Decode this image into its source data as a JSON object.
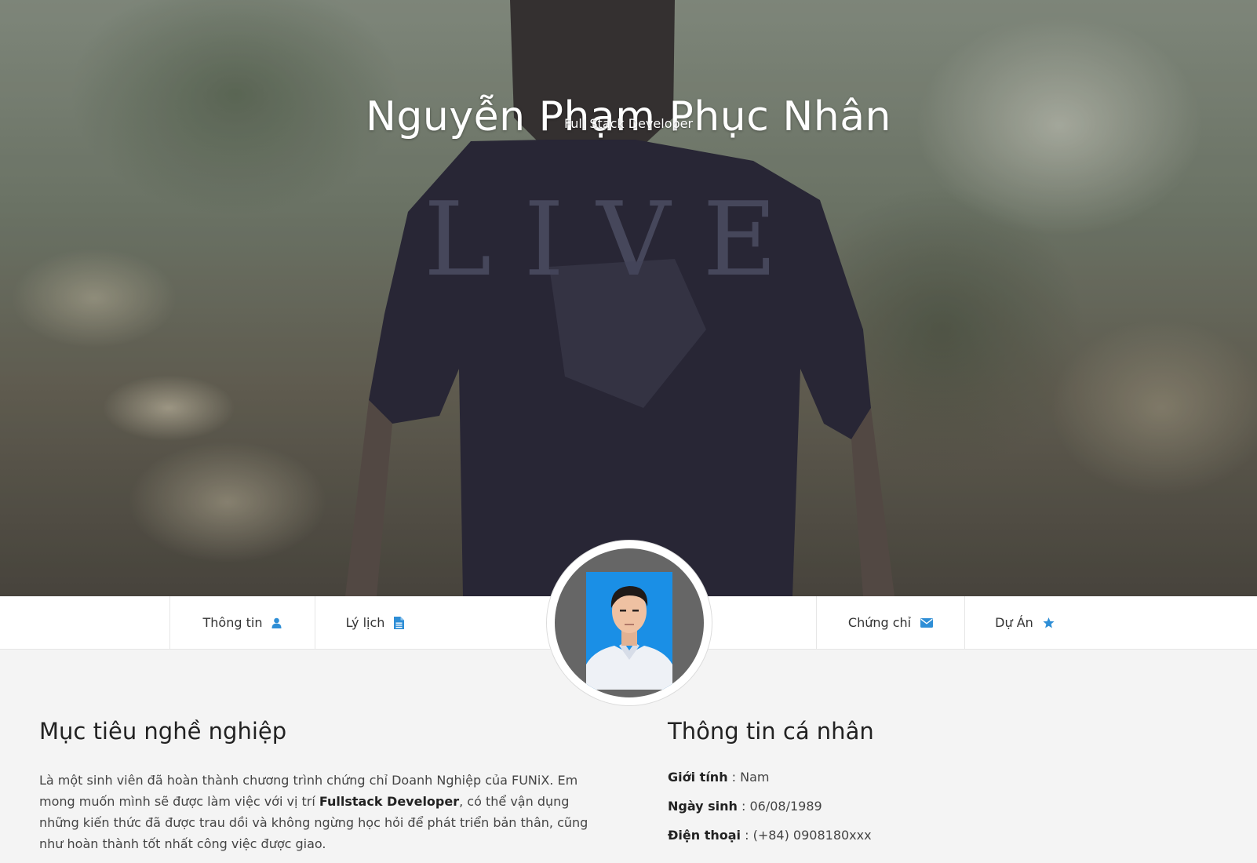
{
  "hero": {
    "name": "Nguyễn Phạm Phục Nhân",
    "title": "Full Stack Developer"
  },
  "nav": {
    "items": [
      {
        "label": "Thông tin",
        "icon": "user-icon"
      },
      {
        "label": "Lý lịch",
        "icon": "document-icon"
      },
      {
        "label": "Chứng chỉ",
        "icon": "envelope-icon"
      },
      {
        "label": "Dự Án",
        "icon": "star-icon"
      }
    ],
    "icon_color": "#2e8ed6"
  },
  "objective": {
    "heading": "Mục tiêu nghề nghiệp",
    "text_before": "Là một sinh viên đã hoàn thành chương trình chứng chỉ Doanh Nghiệp của FUNiX. Em mong muốn mình sẽ được làm việc với vị trí ",
    "highlight": "Fullstack Developer",
    "text_after": ", có thể vận dụng những kiến thức đã được trau dồi và không ngừng học hỏi để phát triển bản thân, cũng như hoàn thành tốt nhất công việc được giao."
  },
  "personal": {
    "heading": "Thông tin cá nhân",
    "rows": [
      {
        "label": "Giới tính",
        "value": "Nam"
      },
      {
        "label": "Ngày sinh",
        "value": "06/08/1989"
      },
      {
        "label": "Điện thoại",
        "value": "(+84) 0908180xxx"
      }
    ]
  }
}
